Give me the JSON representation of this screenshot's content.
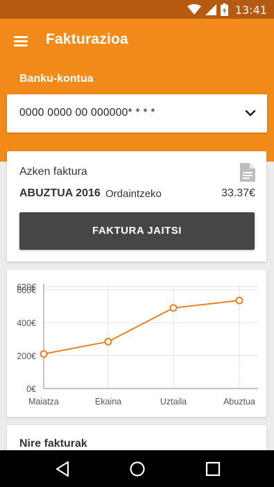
{
  "status_bar": {
    "time": "13:41",
    "icons": [
      "wifi-icon",
      "signal-icon",
      "battery-icon"
    ]
  },
  "app_bar": {
    "title": "Fakturazioa",
    "menu_icon": "menu-icon"
  },
  "account": {
    "label": "Banku-kontua",
    "selected_value": "0000 0000 00 000000* * * *"
  },
  "last_invoice": {
    "title": "Azken faktura",
    "month": "ABUZTUA 2016",
    "status": "Ordaintzeko",
    "amount": "33.37€",
    "download_label": "FAKTURA JAITSI"
  },
  "chart_data": {
    "type": "line",
    "categories": [
      "Maiatza",
      "Ekaina",
      "Uztaila",
      "Abuztua"
    ],
    "series": [
      {
        "values": [
          210,
          285,
          490,
          535
        ],
        "color": "#e8821d"
      }
    ],
    "y_ticks": [
      "0€",
      "200€",
      "400€",
      "600€",
      "620€"
    ],
    "y_tick_values": [
      0,
      200,
      400,
      600,
      620
    ],
    "ylim": [
      0,
      620
    ],
    "grid": true
  },
  "invoices_section": {
    "title": "Nire fakturak"
  },
  "nav_bar": {
    "buttons": [
      "back-icon",
      "home-icon",
      "recents-icon"
    ]
  },
  "colors": {
    "status_bar": "#b55a10",
    "app_bar": "#f28a1a",
    "button_dark": "#464646",
    "line": "#e8821d"
  }
}
